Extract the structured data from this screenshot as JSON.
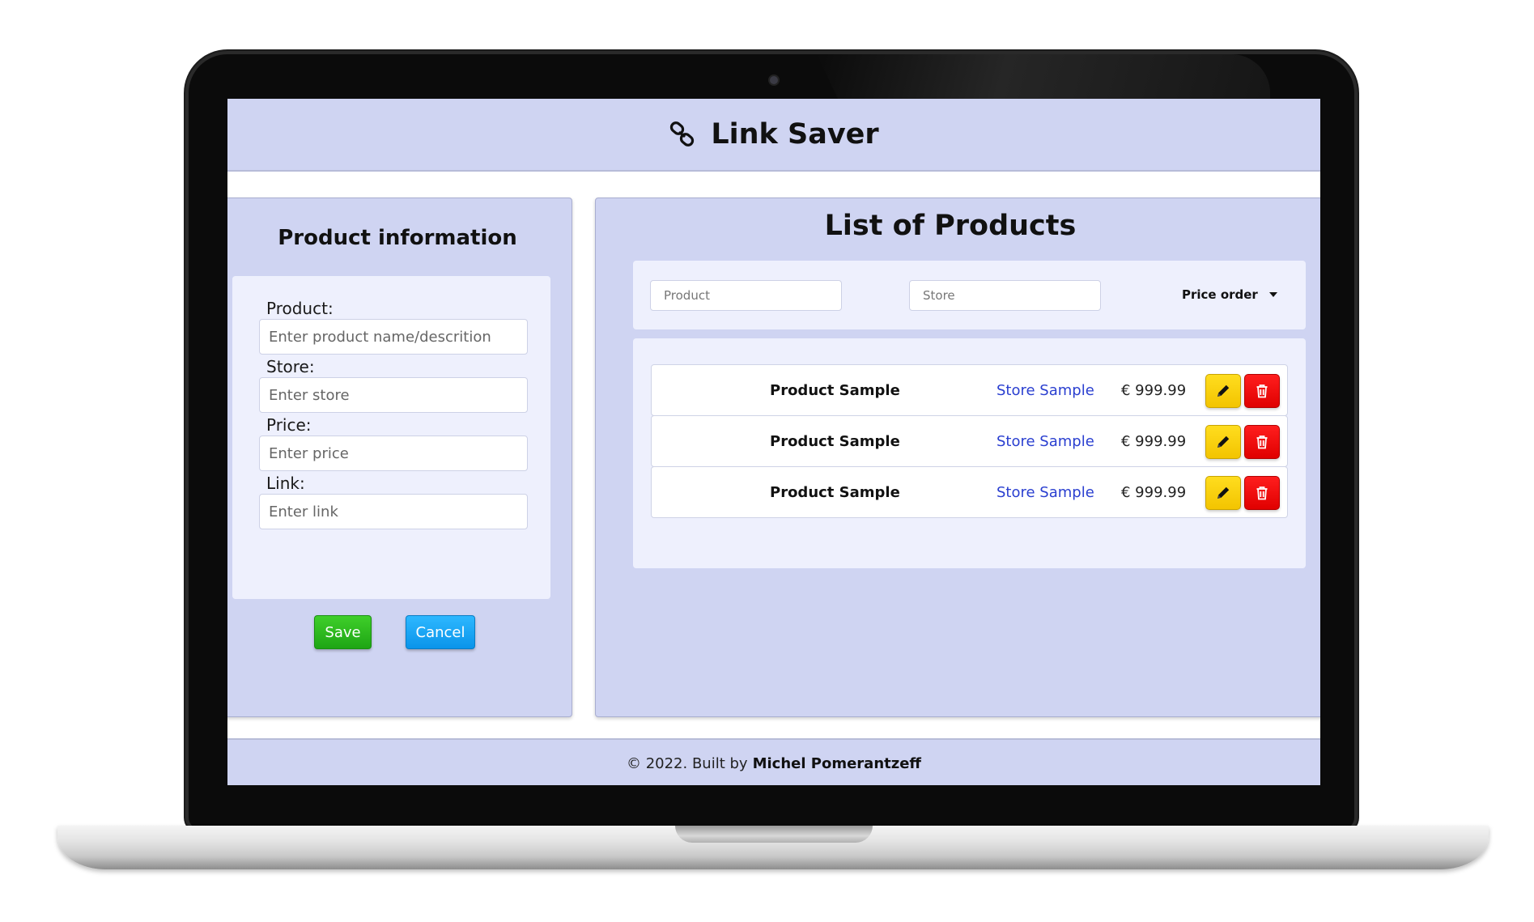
{
  "header": {
    "title": "Link Saver",
    "icon": "link-icon"
  },
  "form": {
    "title": "Product information",
    "fields": [
      {
        "label": "Product:",
        "placeholder": "Enter product name/descrition"
      },
      {
        "label": "Store:",
        "placeholder": "Enter store"
      },
      {
        "label": "Price:",
        "placeholder": "Enter price"
      },
      {
        "label": "Link:",
        "placeholder": "Enter link"
      }
    ],
    "save_label": "Save",
    "cancel_label": "Cancel"
  },
  "list": {
    "title": "List of Products",
    "filters": {
      "product_placeholder": "Product",
      "store_placeholder": "Store",
      "sort_label": "Price order"
    },
    "rows": [
      {
        "product": "Product Sample",
        "store": "Store Sample",
        "price": "€ 999.99"
      },
      {
        "product": "Product Sample",
        "store": "Store Sample",
        "price": "€ 999.99"
      },
      {
        "product": "Product Sample",
        "store": "Store Sample",
        "price": "€ 999.99"
      }
    ]
  },
  "footer": {
    "text": "© 2022. Built by",
    "author": "Michel Pomerantzeff"
  },
  "colors": {
    "panel_bg": "#cfd4f2",
    "card_bg": "#eef0fd",
    "save": "#1ea514",
    "cancel": "#0a94ea",
    "edit": "#f3c400",
    "delete": "#e00000",
    "store_link": "#2a3fd0"
  }
}
